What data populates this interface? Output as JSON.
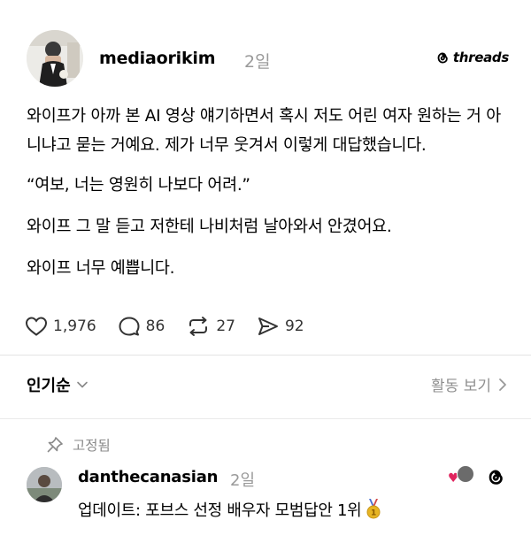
{
  "post": {
    "author": {
      "username": "mediaorikim",
      "time": "2일",
      "avatar_icon": "avatar-photo-icon"
    },
    "brand": {
      "logo_text": "threads",
      "icon": "threads-logo-icon"
    },
    "paragraphs": [
      "와이프가 아까 본 AI 영상 얘기하면서 혹시 저도 어린 여자 원하는 거 아니냐고 묻는 거예요. 제가 너무 웃겨서 이렇게 대답했습니다.",
      "“여보, 너는 영원히 나보다 어려.”",
      "와이프 그 말 듣고 저한테 나비처럼 날아와서 안겼어요.",
      "와이프 너무 예쁩니다."
    ],
    "actions": {
      "likes": "1,976",
      "comments": "86",
      "reposts": "27",
      "shares": "92"
    }
  },
  "sort": {
    "label": "인기순",
    "activity_label": "활동 보기"
  },
  "reply": {
    "pinned_label": "고정됨",
    "username": "danthecanasian",
    "time": "2일",
    "text": "업데이트: 포브스 선정 배우자 모범답안 1위"
  },
  "colors": {
    "text": "#000000",
    "muted": "#9a9a9a",
    "divider": "#e4e4e4",
    "heart": "#e0245e",
    "medal": "#e6b422"
  }
}
